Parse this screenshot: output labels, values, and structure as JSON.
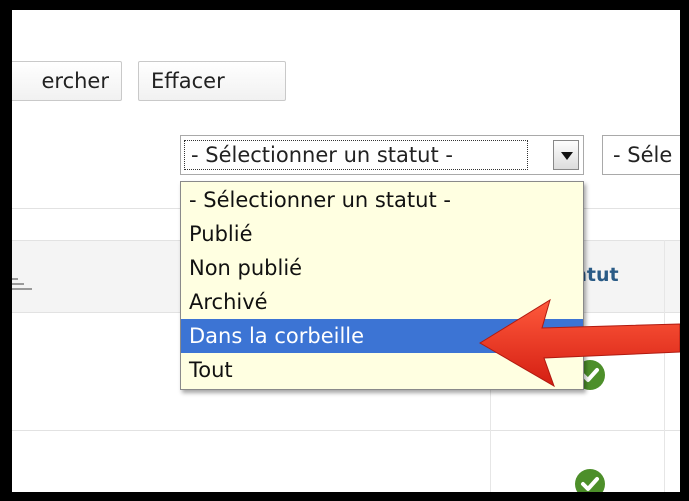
{
  "toolbar": {
    "search_label": "ercher",
    "clear_label": "Effacer"
  },
  "filters": {
    "status_select_value": "- Sélectionner un statut -",
    "second_select_value": "- Séle"
  },
  "table": {
    "status_column_header": "tatut"
  },
  "status_dropdown": {
    "options": [
      "- Sélectionner un statut -",
      "Publié",
      "Non publié",
      "Archivé",
      "Dans la corbeille",
      "Tout"
    ],
    "highlighted": "Dans la corbeille"
  },
  "colors": {
    "highlight": "#3c74d4",
    "dropdown_bg": "#ffffe1",
    "annotation_arrow": "#e8271b",
    "published_check": "#4d8f2a"
  }
}
